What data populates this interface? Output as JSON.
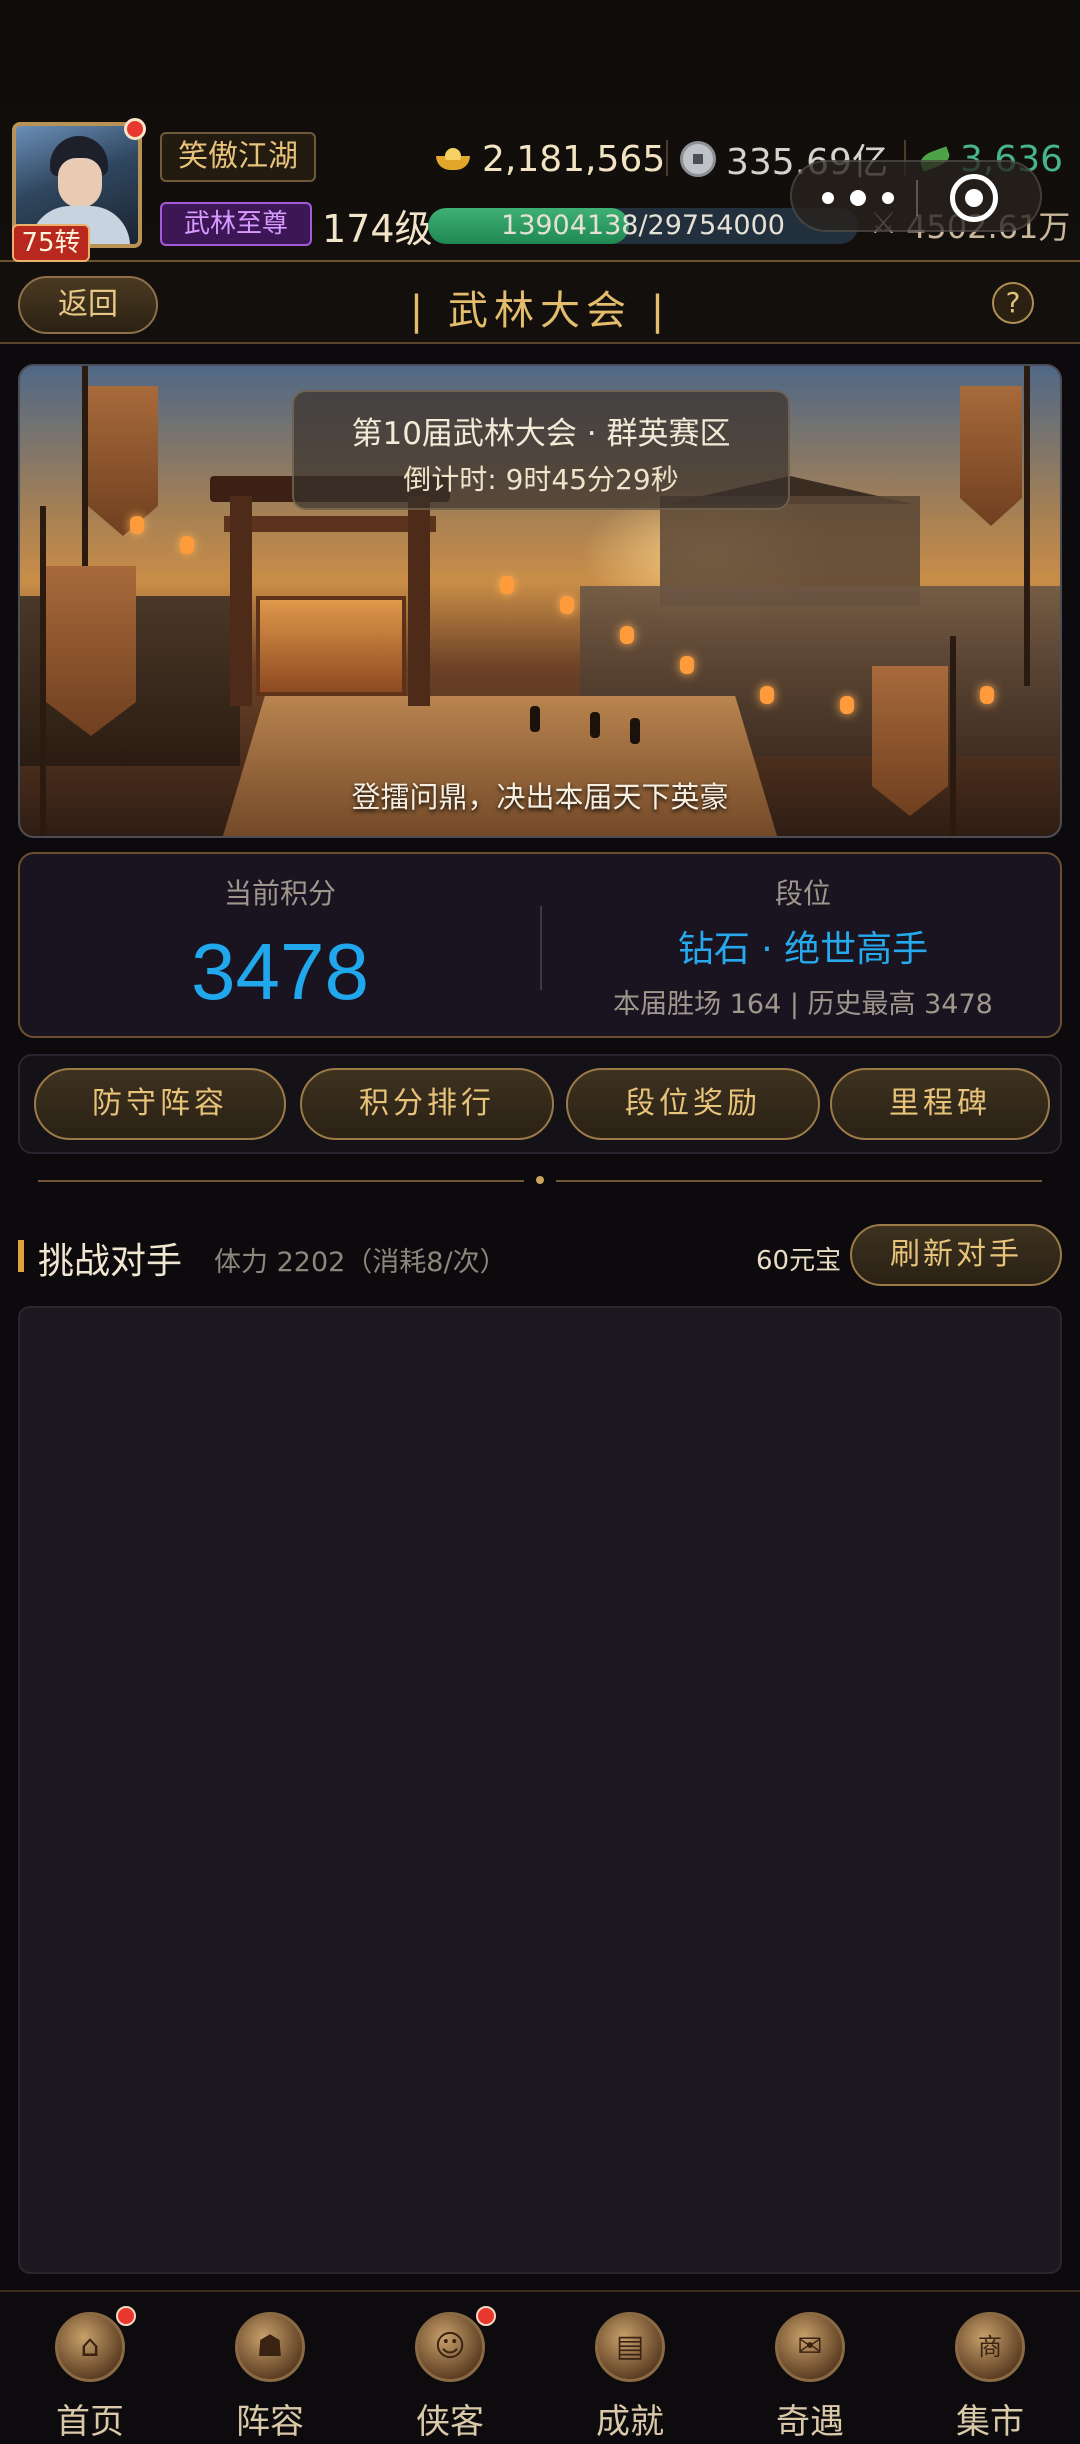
{
  "header": {
    "avatar_alt": "player avatar",
    "rebirth": "75转",
    "guild_name": "笑傲江湖",
    "title_badge": "武林至尊",
    "level": "174级",
    "exp_text": "13904138/29754000",
    "exp_progress": 0.467,
    "gold": "2,181,565",
    "silver": "335.69亿",
    "jade": "3,636",
    "combat_power": "4502.61万"
  },
  "nav": {
    "back": "返回",
    "title": "| 武林大会 |",
    "help": "?"
  },
  "banner": {
    "title": "第10届武林大会 · 群英赛区",
    "countdown": "倒计时: 9时45分29秒",
    "slogan": "登擂问鼎，决出本届天下英豪"
  },
  "score": {
    "label": "当前积分",
    "value": "3478",
    "rank_label": "段位",
    "rank_value": "钻石 · 绝世高手",
    "stats": "本届胜场 164  |  历史最高 3478"
  },
  "actions": [
    "防守阵容",
    "积分排行",
    "段位奖励",
    "里程碑"
  ],
  "challenge": {
    "title": "挑战对手",
    "stamina": "体力 2202（消耗8/次）",
    "price": "60元宝",
    "refresh": "刷新对手"
  },
  "tabs": [
    {
      "label": "首页",
      "icon": "home-icon",
      "glyph": "⌂",
      "dot": true
    },
    {
      "label": "阵容",
      "icon": "team-icon",
      "glyph": "☗",
      "dot": false
    },
    {
      "label": "侠客",
      "icon": "hero-icon",
      "glyph": "☺",
      "dot": true
    },
    {
      "label": "成就",
      "icon": "book-icon",
      "glyph": "▤",
      "dot": false
    },
    {
      "label": "奇遇",
      "icon": "scroll-icon",
      "glyph": "✉",
      "dot": false
    },
    {
      "label": "集市",
      "icon": "shop-icon",
      "glyph": "商",
      "dot": false
    }
  ],
  "colors": {
    "accent_gold": "#e0b66b",
    "score_blue": "#21a7ec",
    "jade_green": "#48b48a",
    "badge_red": "#e8372f"
  }
}
